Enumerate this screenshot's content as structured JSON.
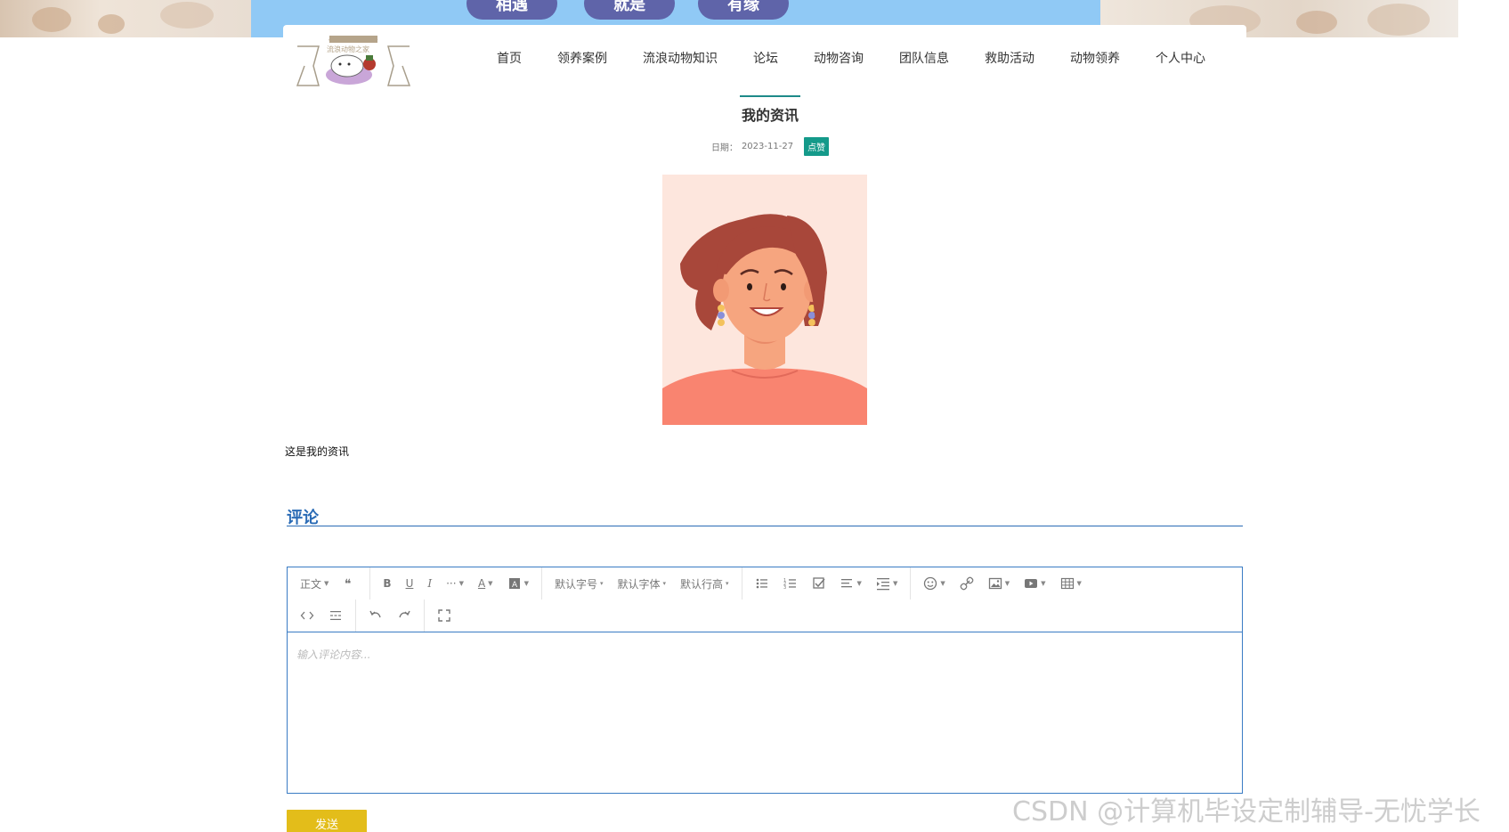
{
  "banner": {
    "pills": [
      "相遇",
      "就是",
      "有缘"
    ],
    "colors": {
      "sky": "#90c9f5",
      "pill": "#5f64a9"
    }
  },
  "header": {
    "logo_text": "流浪动物之家",
    "nav": [
      "首页",
      "领养案例",
      "流浪动物知识",
      "论坛",
      "动物咨询",
      "团队信息",
      "救助活动",
      "动物领养",
      "个人中心"
    ]
  },
  "article": {
    "title": "我的资讯",
    "date_label": "日期：",
    "date": "2023-11-27",
    "like_label": "点赞",
    "body": "这是我的资讯"
  },
  "comments": {
    "heading": "评论",
    "toolbar": {
      "paragraph": "正文",
      "font_size": "默认字号",
      "font_family": "默认字体",
      "line_height": "默认行高"
    },
    "placeholder": "输入评论内容...",
    "send_label": "发送"
  },
  "watermark": "CSDN @计算机毕设定制辅导-无忧学长",
  "theme": {
    "accent": "#1e8a89",
    "comment_blue": "#2a6bb5",
    "send_yellow": "#e3bd1a"
  }
}
